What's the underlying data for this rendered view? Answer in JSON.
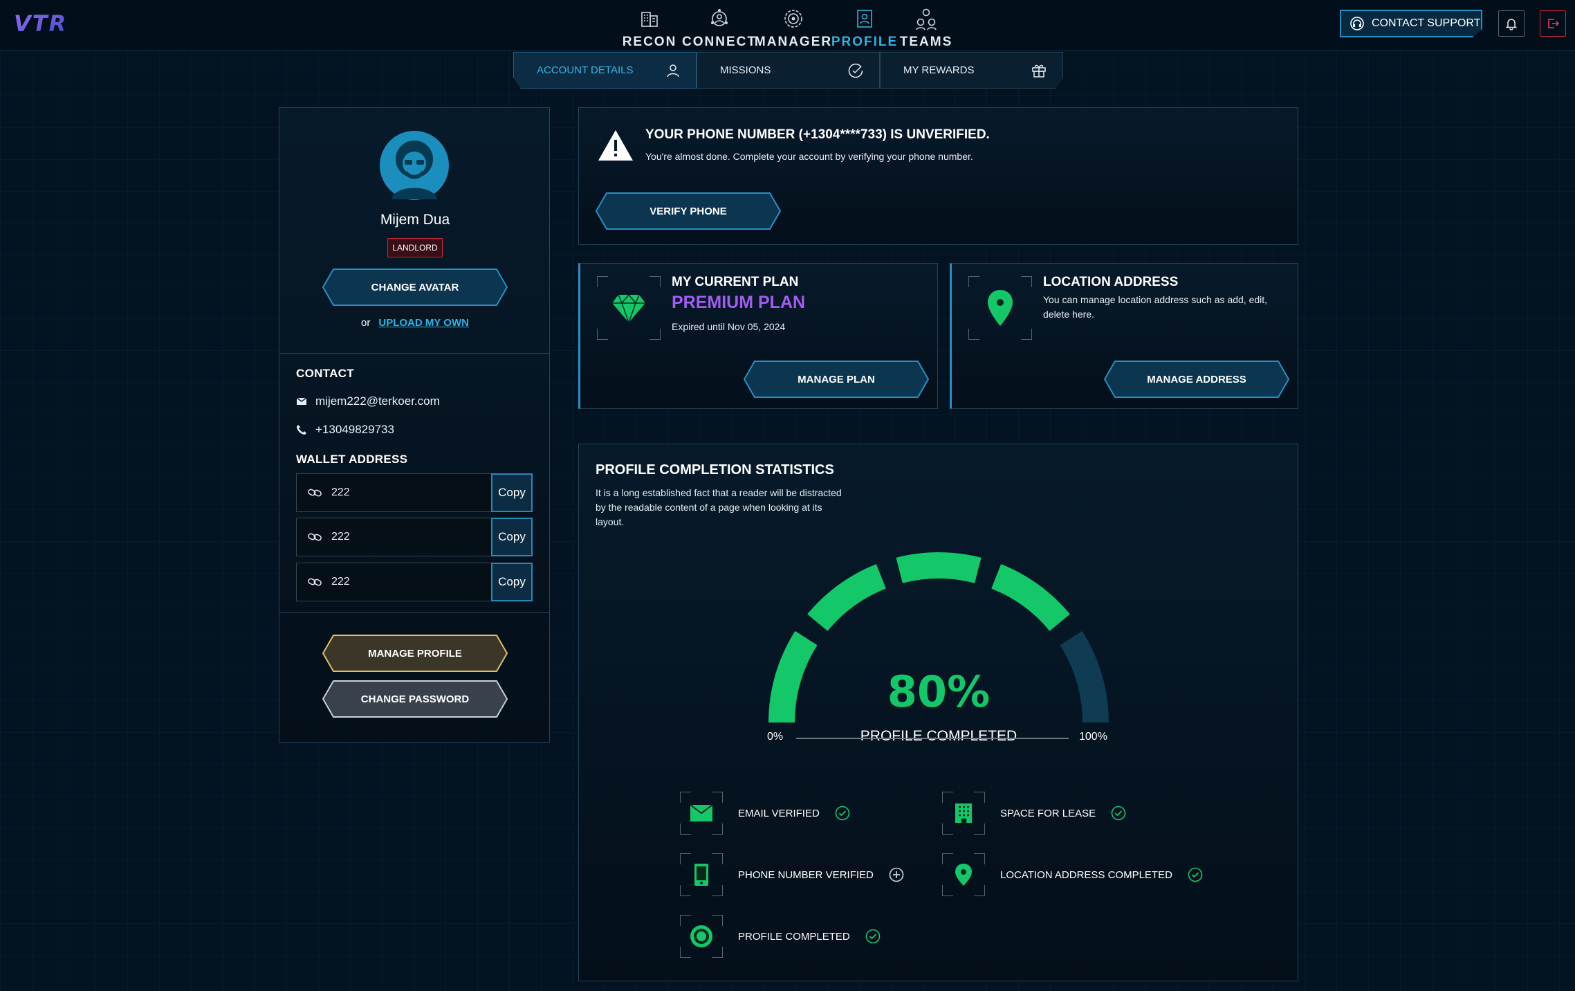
{
  "brand": {
    "logo_text": "VTR"
  },
  "nav": {
    "items": [
      {
        "label": "RECON",
        "icon": "building-icon"
      },
      {
        "label": "CONNECT",
        "icon": "connect-icon"
      },
      {
        "label": "MANAGER",
        "icon": "manager-icon"
      },
      {
        "label": "PROFILE",
        "icon": "profile-icon",
        "active": true
      },
      {
        "label": "TEAMS",
        "icon": "teams-icon"
      }
    ],
    "contact_support": "CONTACT SUPPORT"
  },
  "tabs": [
    {
      "label": "ACCOUNT DETAILS",
      "active": true
    },
    {
      "label": "MISSIONS"
    },
    {
      "label": "MY REWARDS"
    }
  ],
  "profile": {
    "name": "Mijem Dua",
    "role_badge": "LANDLORD",
    "change_avatar": "CHANGE AVATAR",
    "or_text": "or",
    "upload_link": "UPLOAD MY OWN"
  },
  "contact": {
    "heading": "CONTACT",
    "email": "mijem222@terkoer.com",
    "phone": "+13049829733"
  },
  "wallet": {
    "heading": "WALLET ADDRESS",
    "rows": [
      {
        "value": "222",
        "copy": "Copy"
      },
      {
        "value": "222",
        "copy": "Copy"
      },
      {
        "value": "222",
        "copy": "Copy"
      }
    ]
  },
  "profile_actions": {
    "manage": "MANAGE PROFILE",
    "change_password": "CHANGE PASSWORD"
  },
  "phone_alert": {
    "title": "YOUR PHONE NUMBER (+1304****733) IS UNVERIFIED.",
    "message": "You're almost done. Complete your account by verifying your phone number.",
    "button": "VERIFY PHONE"
  },
  "plan": {
    "heading": "MY CURRENT PLAN",
    "name": "PREMIUM PLAN",
    "expiry": "Expired until Nov 05, 2024",
    "button": "MANAGE PLAN"
  },
  "address": {
    "heading": "LOCATION ADDRESS",
    "description": "You can manage location address such as add, edit, delete here.",
    "button": "MANAGE ADDRESS"
  },
  "stats": {
    "heading": "PROFILE COMPLETION STATISTICS",
    "description": "It is a long established fact that a reader will be distracted by the readable content of a page when looking at its layout.",
    "percent_text": "80%",
    "percent_value": 80,
    "caption": "PROFILE COMPLETED",
    "min_label": "0%",
    "max_label": "100%",
    "items": [
      {
        "label": "EMAIL VERIFIED",
        "status": "done"
      },
      {
        "label": "SPACE FOR LEASE",
        "status": "done"
      },
      {
        "label": "PHONE NUMBER VERIFIED",
        "status": "pending"
      },
      {
        "label": "LOCATION ADDRESS COMPLETED",
        "status": "done"
      },
      {
        "label": "PROFILE COMPLETED",
        "status": "done"
      }
    ]
  },
  "colors": {
    "accent": "#2fb3e4",
    "success": "#14c86a",
    "premium": "#a45cf0",
    "danger": "#d4253a",
    "gauge_track": "#0f3c52"
  }
}
